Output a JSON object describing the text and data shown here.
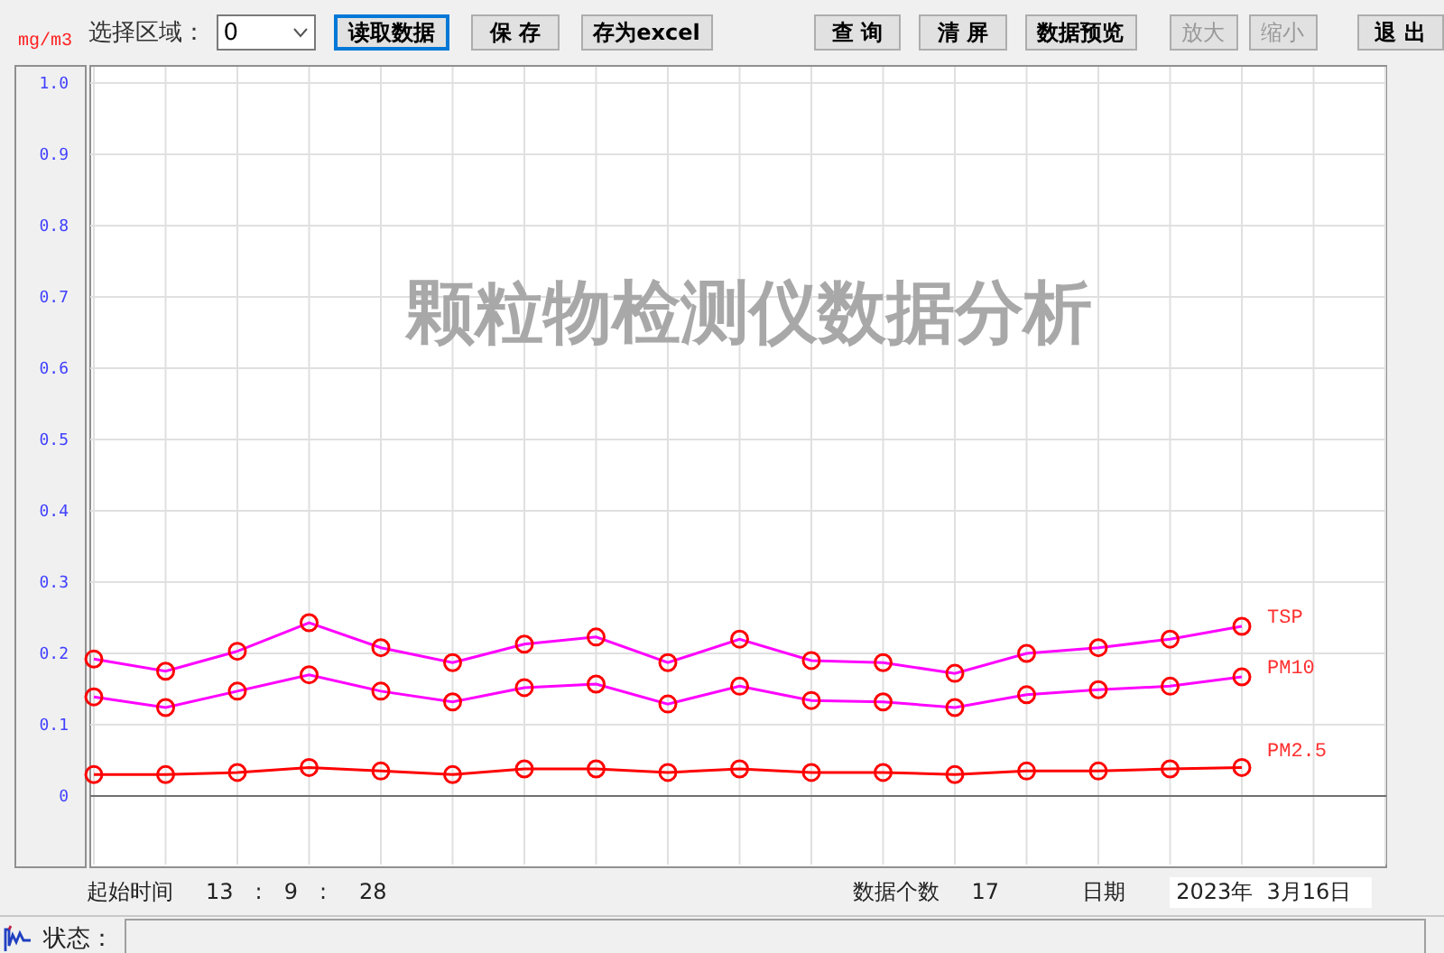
{
  "toolbar": {
    "region_label": "选择区域：",
    "region_value": "0",
    "buttons": [
      {
        "label": "读取数据",
        "focused": true,
        "disabled": false
      },
      {
        "label": "保 存",
        "focused": false,
        "disabled": false
      },
      {
        "label": "存为excel",
        "focused": false,
        "disabled": false
      },
      {
        "label": "查 询",
        "focused": false,
        "disabled": false
      },
      {
        "label": "清 屏",
        "focused": false,
        "disabled": false
      },
      {
        "label": "数据预览",
        "focused": false,
        "disabled": false
      },
      {
        "label": "放大",
        "focused": false,
        "disabled": true
      },
      {
        "label": "缩小",
        "focused": false,
        "disabled": true
      },
      {
        "label": "退 出",
        "focused": false,
        "disabled": false
      }
    ]
  },
  "chart": {
    "chart_data": {
      "type": "line",
      "title": "颗粒物检测仪数据分析",
      "ylabel": "mg/m3",
      "grid": true,
      "ylim": [
        0,
        1
      ],
      "yticks": [
        0,
        0.1,
        0.2,
        0.3,
        0.4,
        0.5,
        0.6,
        0.7,
        0.8,
        0.9,
        {
          "value": 1,
          "label": "1.0"
        }
      ],
      "series": [
        {
          "name": "TSP",
          "color": "#ff00ff",
          "marker": "circle",
          "values": [
            0.192,
            0.175,
            0.203,
            0.243,
            0.208,
            0.187,
            0.213,
            0.223,
            0.187,
            0.22,
            0.19,
            0.187,
            0.172,
            0.2,
            0.208,
            0.22,
            0.238
          ]
        },
        {
          "name": "PM10",
          "color": "#ff00ff",
          "marker": "circle",
          "values": [
            0.139,
            0.124,
            0.147,
            0.17,
            0.147,
            0.132,
            0.152,
            0.157,
            0.129,
            0.154,
            0.134,
            0.132,
            0.124,
            0.142,
            0.149,
            0.154,
            0.167
          ]
        },
        {
          "name": "PM2.5",
          "color": "#ff0000",
          "marker": "circle",
          "values": [
            0.03,
            0.03,
            0.033,
            0.04,
            0.035,
            0.03,
            0.038,
            0.038,
            0.033,
            0.038,
            0.033,
            0.033,
            0.03,
            0.035,
            0.035,
            0.038,
            0.04
          ]
        }
      ]
    }
  },
  "footer": {
    "start_label": "起始时间",
    "hour": "13",
    "sep1": ":",
    "minute": "9",
    "sep2": ":",
    "second": "28",
    "count_label": "数据个数",
    "count": "17",
    "date_label": "日期",
    "date": "2023年  3月16日"
  },
  "status_bar": {
    "label": "状态："
  }
}
